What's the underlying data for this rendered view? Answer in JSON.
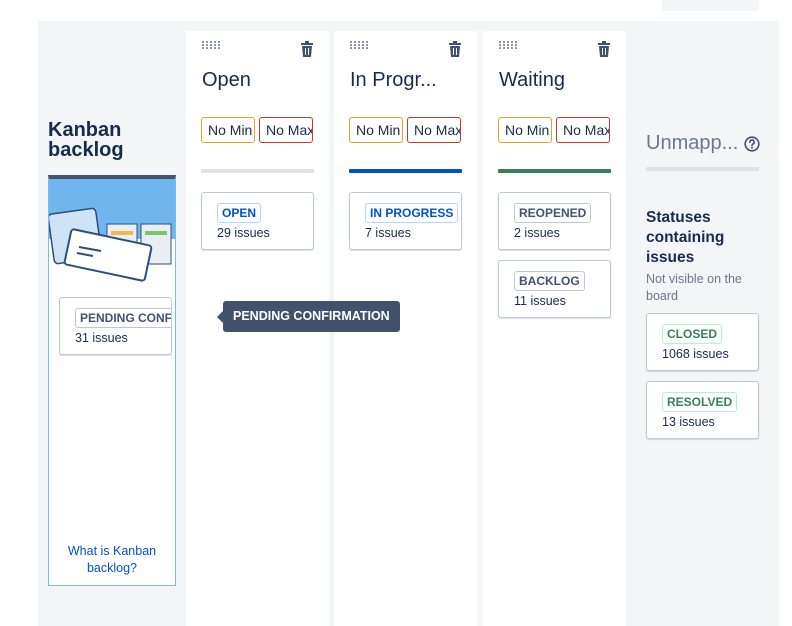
{
  "backlog": {
    "title": "Kanban backlog",
    "link": "What is Kanban backlog?",
    "card": {
      "status": "PENDING CONFIRMATION",
      "count": "31 issues"
    }
  },
  "tooltip": {
    "text": "PENDING CONFIRMATION"
  },
  "columns": [
    {
      "title": "Open",
      "min": "No Min",
      "max": "No Max",
      "bar_color": "#dfe1e6",
      "cards": [
        {
          "status": "OPEN",
          "count": "29 issues"
        }
      ]
    },
    {
      "title": "In Progr...",
      "min": "No Min",
      "max": "No Max",
      "bar_color": "#0052cc",
      "cards": [
        {
          "status": "IN PROGRESS",
          "count": "7 issues"
        }
      ]
    },
    {
      "title": "Waiting",
      "min": "No Min",
      "max": "No Max",
      "bar_color": "#36805a",
      "cards": [
        {
          "status": "REOPENED",
          "count": "2 issues"
        },
        {
          "status": "BACKLOG",
          "count": "11 issues"
        }
      ]
    }
  ],
  "unmapped": {
    "title": "Unmapp...",
    "heading": "Statuses containing issues",
    "sub": "Not visible on the board",
    "cards": [
      {
        "status": "CLOSED",
        "count": "1068 issues"
      },
      {
        "status": "RESOLVED",
        "count": "13 issues"
      }
    ]
  },
  "icons": {
    "drag": "drag-handle-icon",
    "trash": "trash-icon",
    "help": "help-icon"
  },
  "colors": {
    "accent_blue": "#0052cc",
    "done_green": "#36805a",
    "todo_grey": "#42526e",
    "min_border": "#dfa72d",
    "max_border": "#c23b27"
  }
}
